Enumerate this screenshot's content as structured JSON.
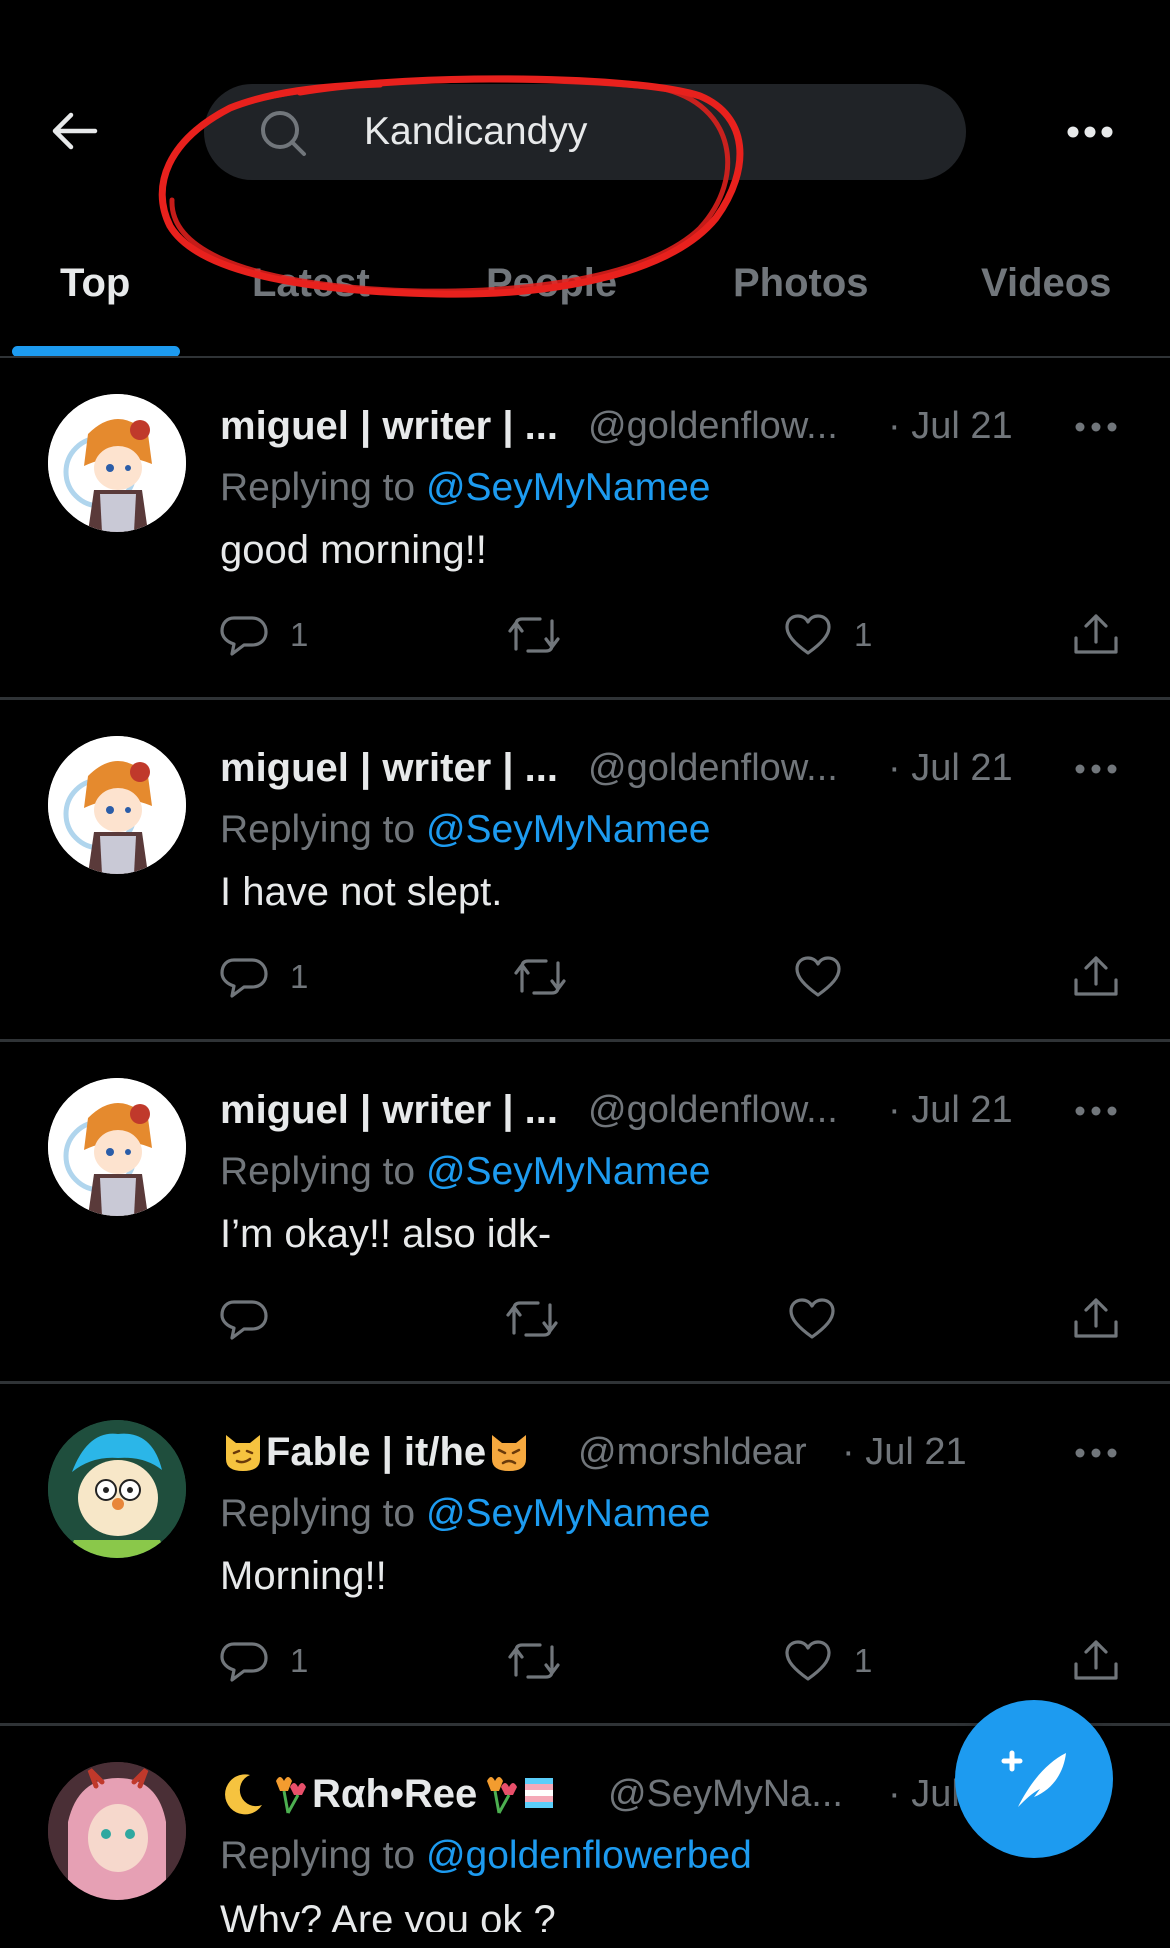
{
  "search": {
    "query": "Kandicandyy"
  },
  "tabs": [
    {
      "label": "Top",
      "active": true
    },
    {
      "label": "Latest",
      "active": false
    },
    {
      "label": "People",
      "active": false
    },
    {
      "label": "Photos",
      "active": false
    },
    {
      "label": "Videos",
      "active": false
    }
  ],
  "tweets": [
    {
      "name": "miguel | writer | ...",
      "handle": "@goldenflow...",
      "date": "· Jul 21",
      "reply_prefix": "Replying to ",
      "reply_to": "@SeyMyNamee",
      "text": "good morning!!",
      "replies": "1",
      "retweets": "",
      "likes": "1"
    },
    {
      "name": "miguel | writer | ...",
      "handle": "@goldenflow...",
      "date": "· Jul 21",
      "reply_prefix": "Replying to ",
      "reply_to": "@SeyMyNamee",
      "text": "I have not slept.",
      "replies": "1",
      "retweets": "",
      "likes": ""
    },
    {
      "name": "miguel | writer | ...",
      "handle": "@goldenflow...",
      "date": "· Jul 21",
      "reply_prefix": "Replying to ",
      "reply_to": "@SeyMyNamee",
      "text": "I’m okay!! also idk-",
      "replies": "",
      "retweets": "",
      "likes": ""
    },
    {
      "name": "Fable | it/he",
      "handle": "@morshldear",
      "date": "· Jul 21",
      "reply_prefix": "Replying to ",
      "reply_to": "@SeyMyNamee",
      "text": "Morning!!",
      "replies": "1",
      "retweets": "",
      "likes": "1"
    },
    {
      "name": "Rαh•Ree",
      "handle": "@SeyMyNa...",
      "date": "· Jul",
      "reply_prefix": "Replying to ",
      "reply_to": "@goldenflowerbed",
      "text": "Why? Are you ok ?",
      "replies": "",
      "retweets": "",
      "likes": ""
    }
  ],
  "colors": {
    "accent": "#1d9bf0",
    "annotation": "#e8211d"
  }
}
